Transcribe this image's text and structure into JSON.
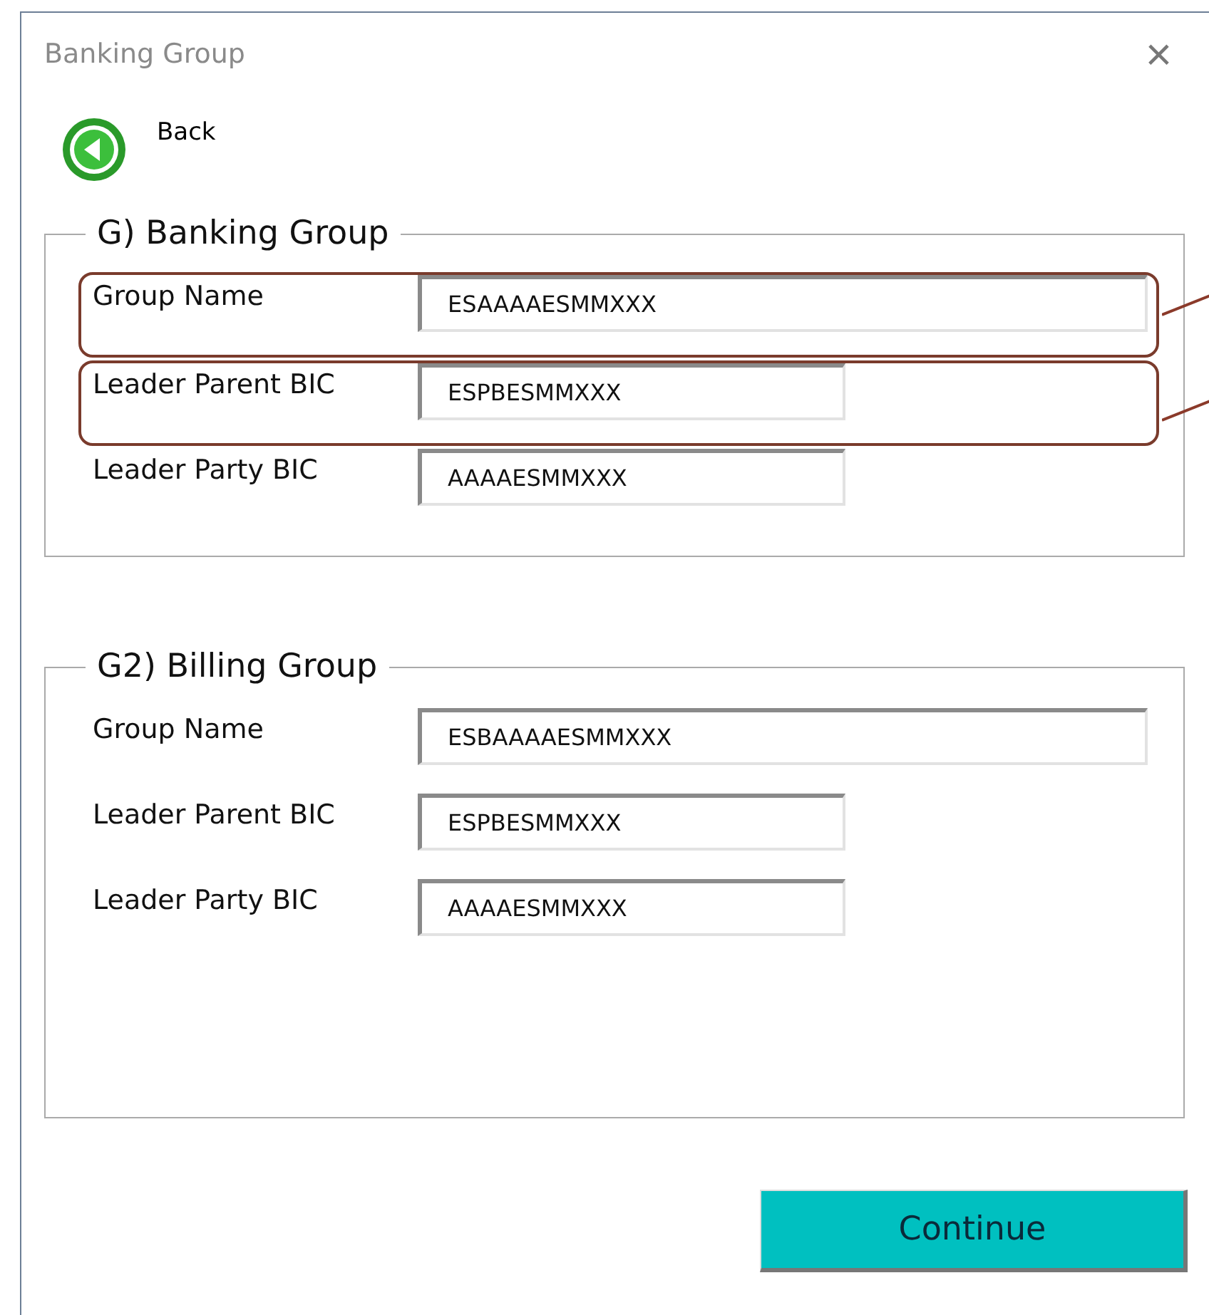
{
  "window": {
    "title": "Banking Group",
    "close": "×"
  },
  "back": {
    "label": "Back"
  },
  "groups": [
    {
      "title": "G) Banking Group",
      "fields": [
        {
          "label": "Group Name",
          "value": "ESAAAAESMMXXX",
          "wide": true,
          "highlighted": true
        },
        {
          "label": "Leader Parent BIC",
          "value": "ESPBESMMXXX",
          "wide": false,
          "highlighted": true
        },
        {
          "label": "Leader Party BIC",
          "value": "AAAAESMMXXX",
          "wide": false,
          "highlighted": false
        }
      ]
    },
    {
      "title": "G2) Billing Group",
      "fields": [
        {
          "label": "Group Name",
          "value": "ESBAAAAESMMXXX",
          "wide": true,
          "highlighted": false
        },
        {
          "label": "Leader Parent BIC",
          "value": "ESPBESMMXXX",
          "wide": false,
          "highlighted": false
        },
        {
          "label": "Leader Party BIC",
          "value": "AAAAESMMXXX",
          "wide": false,
          "highlighted": false
        }
      ]
    }
  ],
  "buttons": [
    "Continue"
  ]
}
